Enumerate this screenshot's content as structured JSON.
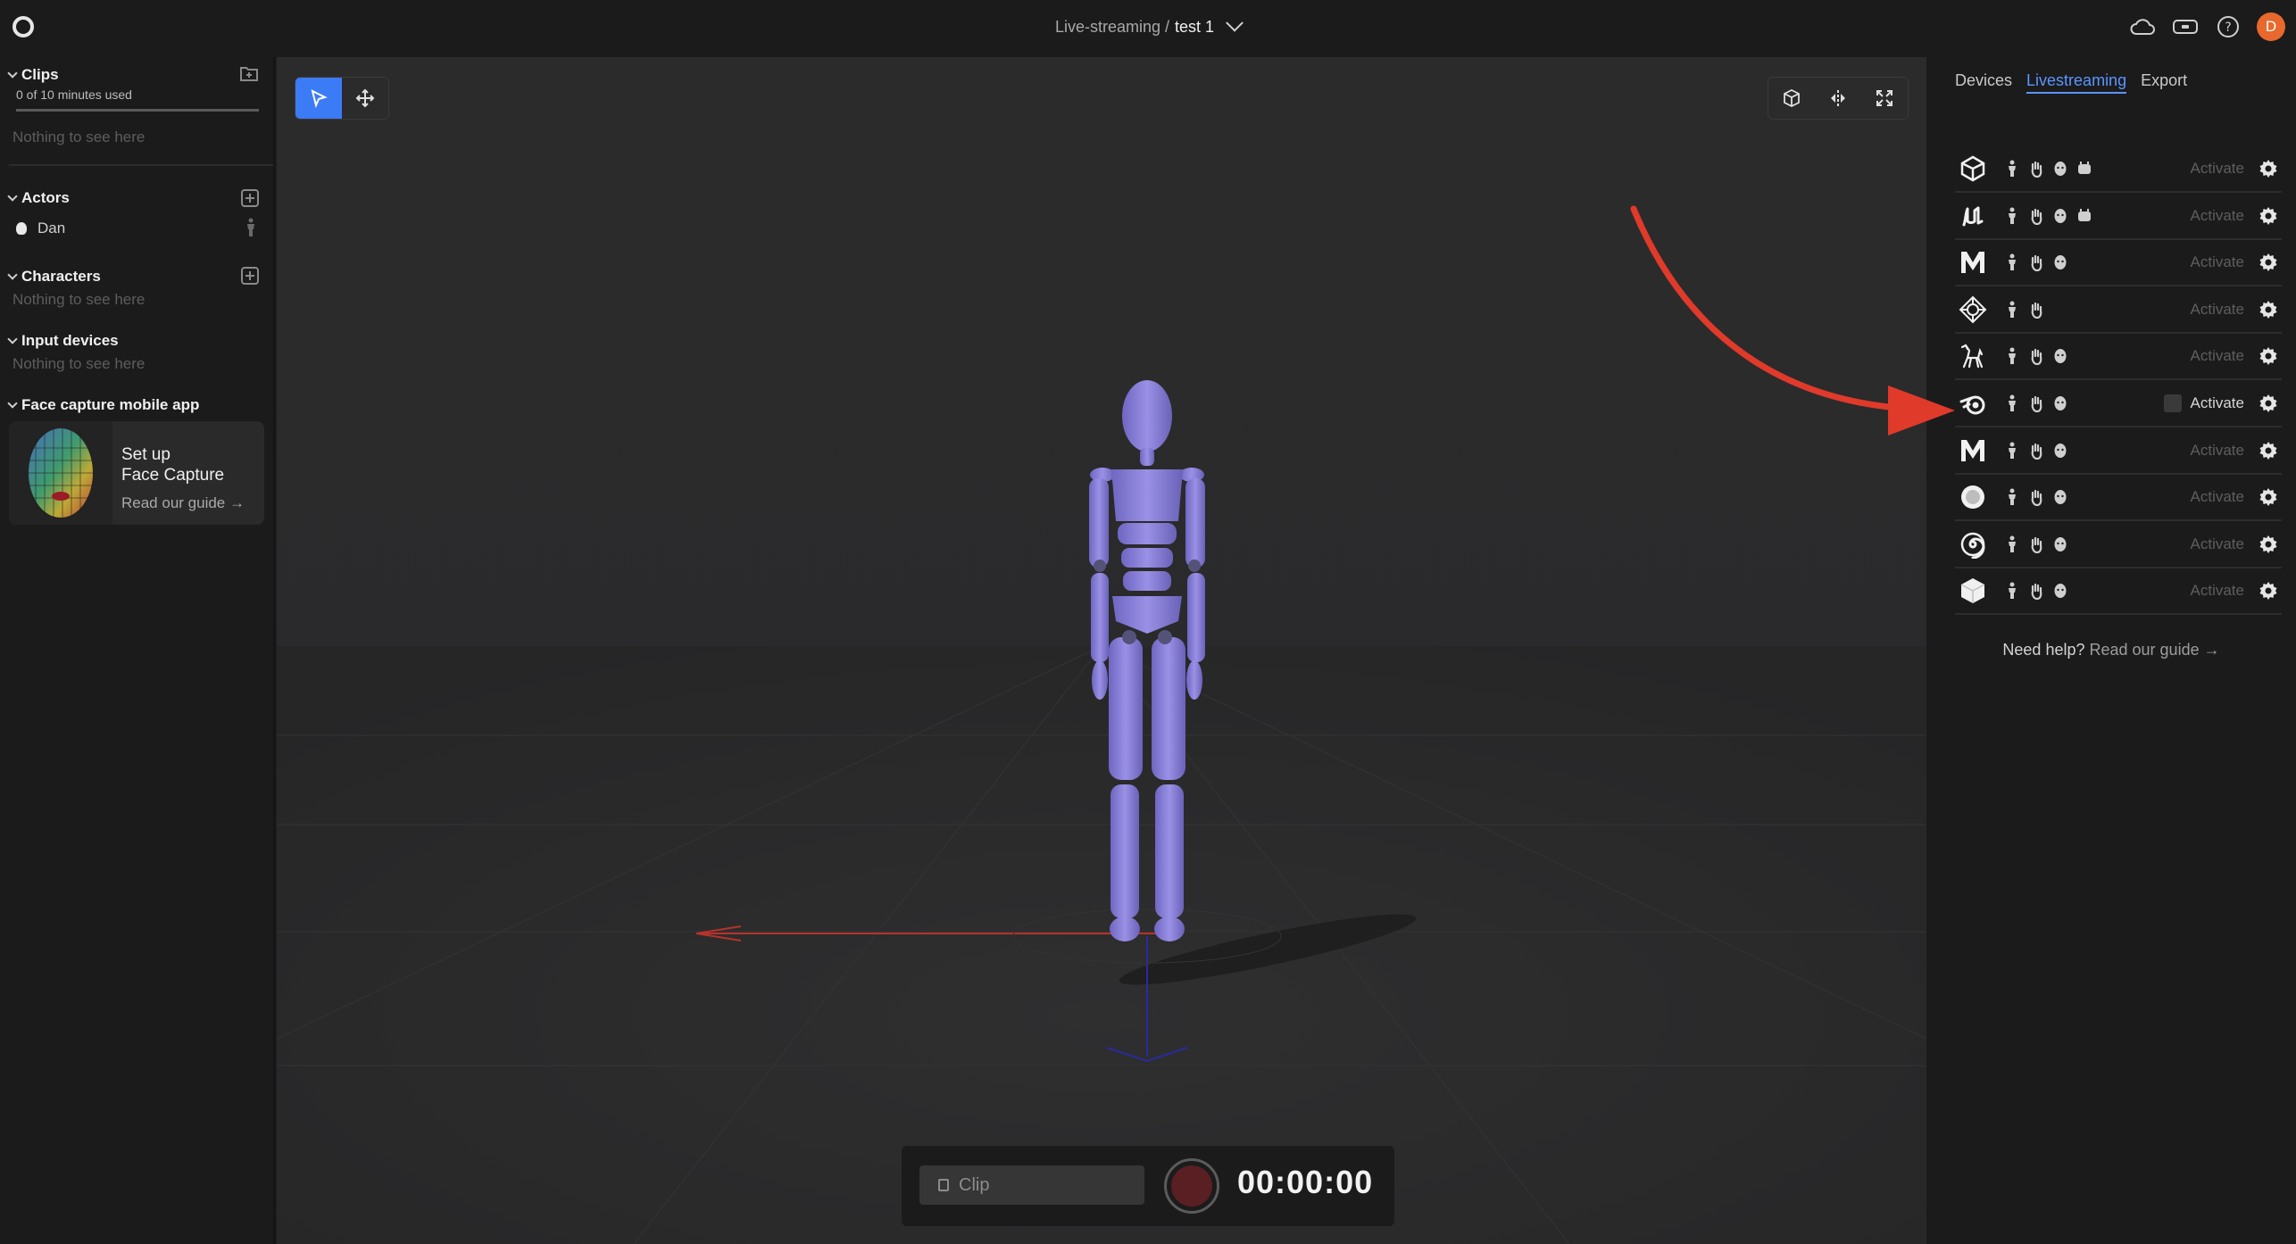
{
  "topbar": {
    "breadcrumb_parent": "Live-streaming /",
    "breadcrumb_current": "test 1",
    "avatar_letter": "D"
  },
  "sidebar": {
    "clips": {
      "title": "Clips",
      "usage": "0 of 10 minutes used",
      "empty": "Nothing to see here"
    },
    "actors": {
      "title": "Actors",
      "items": [
        {
          "name": "Dan"
        }
      ]
    },
    "characters": {
      "title": "Characters",
      "empty": "Nothing to see here"
    },
    "input_devices": {
      "title": "Input devices",
      "empty": "Nothing to see here"
    },
    "face_capture": {
      "title": "Face capture mobile app",
      "card_line1": "Set up",
      "card_line2": "Face Capture",
      "card_link": "Read our guide →"
    }
  },
  "viewport": {
    "clip_placeholder": "Clip",
    "timer": "00:00:00"
  },
  "right_panel": {
    "tabs": [
      {
        "label": "Devices"
      },
      {
        "label": "Livestreaming"
      },
      {
        "label": "Export"
      }
    ],
    "active_tab": "Livestreaming",
    "activate_label": "Activate",
    "rows": [
      {
        "logo": "unity-icon",
        "caps": [
          "body",
          "hand",
          "face",
          "device"
        ],
        "enabled": false
      },
      {
        "logo": "unreal-icon",
        "caps": [
          "body",
          "hand",
          "face",
          "device"
        ],
        "enabled": false
      },
      {
        "logo": "maya-icon",
        "caps": [
          "body",
          "hand",
          "face"
        ],
        "enabled": false
      },
      {
        "logo": "motionbuilder-icon",
        "caps": [
          "body",
          "hand"
        ],
        "enabled": false
      },
      {
        "logo": "isadora-icon",
        "caps": [
          "body",
          "hand",
          "face"
        ],
        "enabled": false
      },
      {
        "logo": "blender-icon",
        "caps": [
          "body",
          "hand",
          "face"
        ],
        "enabled": true
      },
      {
        "logo": "maya-icon",
        "caps": [
          "body",
          "hand",
          "face"
        ],
        "enabled": false
      },
      {
        "logo": "cinema4d-icon",
        "caps": [
          "body",
          "hand",
          "face"
        ],
        "enabled": false
      },
      {
        "logo": "houdini-icon",
        "caps": [
          "body",
          "hand",
          "face"
        ],
        "enabled": false
      },
      {
        "logo": "cube-icon",
        "caps": [
          "body",
          "hand",
          "face"
        ],
        "enabled": false
      }
    ],
    "help_text": "Need help?",
    "help_link": "Read our guide →"
  },
  "colors": {
    "accent": "#3b7cf6",
    "avatar": "#e8682d",
    "character": "#8b82d6",
    "annotation": "#e03a2a"
  }
}
